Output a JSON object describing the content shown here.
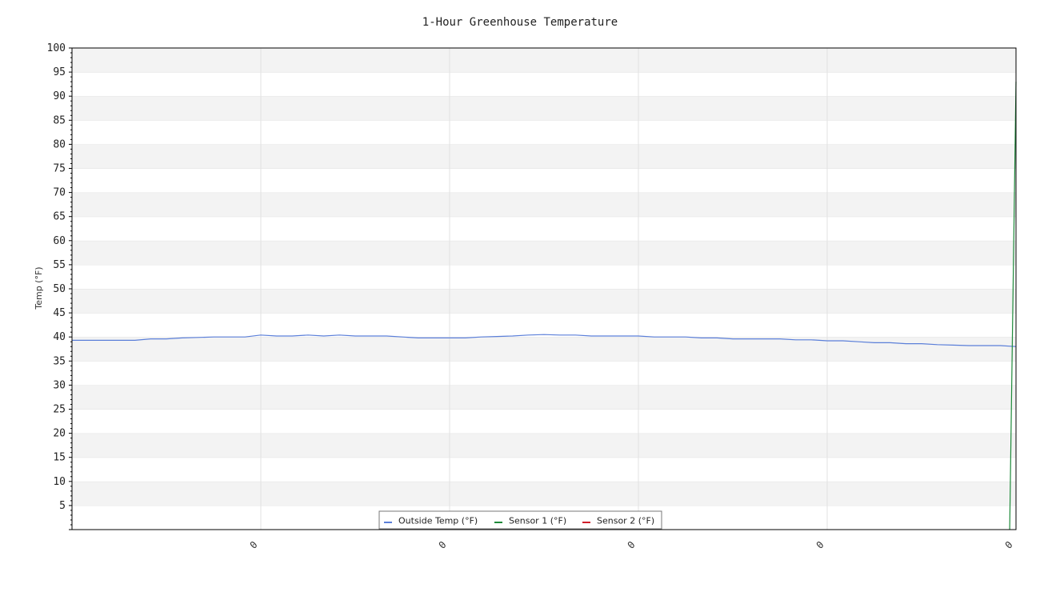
{
  "chart_data": {
    "type": "line",
    "title": "1-Hour Greenhouse Temperature",
    "xlabel": "",
    "ylabel": "Temp (°F)",
    "ylim": [
      0,
      100
    ],
    "yticks": [
      5,
      10,
      15,
      20,
      25,
      30,
      35,
      40,
      45,
      50,
      55,
      60,
      65,
      70,
      75,
      80,
      85,
      90,
      95,
      100
    ],
    "xlim": [
      0,
      60
    ],
    "xtick_positions": [
      12,
      24,
      36,
      48,
      60
    ],
    "xtick_labels": [
      "0",
      "0",
      "0",
      "0",
      "0"
    ],
    "grid": true,
    "legend_position": "bottom-center",
    "series": [
      {
        "name": "Outside Temp (°F)",
        "color": "#5b7fd9",
        "x": [
          0,
          4,
          5,
          6,
          7,
          8,
          9,
          10,
          11,
          12,
          13,
          14,
          15,
          16,
          17,
          18,
          19,
          20,
          21,
          22,
          23,
          24,
          25,
          26,
          27,
          28,
          29,
          30,
          31,
          32,
          33,
          34,
          35,
          36,
          37,
          38,
          39,
          40,
          41,
          42,
          43,
          44,
          45,
          46,
          47,
          48,
          49,
          50,
          51,
          52,
          53,
          54,
          55,
          56,
          57,
          58,
          59,
          60
        ],
        "y": [
          39.3,
          39.3,
          39.6,
          39.6,
          39.8,
          39.9,
          40.0,
          40.0,
          40.0,
          40.4,
          40.2,
          40.2,
          40.4,
          40.2,
          40.4,
          40.2,
          40.2,
          40.2,
          40.0,
          39.8,
          39.8,
          39.8,
          39.8,
          40.0,
          40.1,
          40.2,
          40.4,
          40.5,
          40.4,
          40.4,
          40.2,
          40.2,
          40.2,
          40.2,
          40.0,
          40.0,
          40.0,
          39.8,
          39.8,
          39.6,
          39.6,
          39.6,
          39.6,
          39.4,
          39.4,
          39.2,
          39.2,
          39.0,
          38.8,
          38.8,
          38.6,
          38.6,
          38.4,
          38.3,
          38.2,
          38.2,
          38.2,
          38.0
        ]
      },
      {
        "name": "Sensor 1 (°F)",
        "color": "#1e8a3a",
        "x": [
          59.6,
          60
        ],
        "y": [
          0,
          93
        ]
      },
      {
        "name": "Sensor 2 (°F)",
        "color": "#d01f2b",
        "x": [],
        "y": []
      }
    ]
  }
}
